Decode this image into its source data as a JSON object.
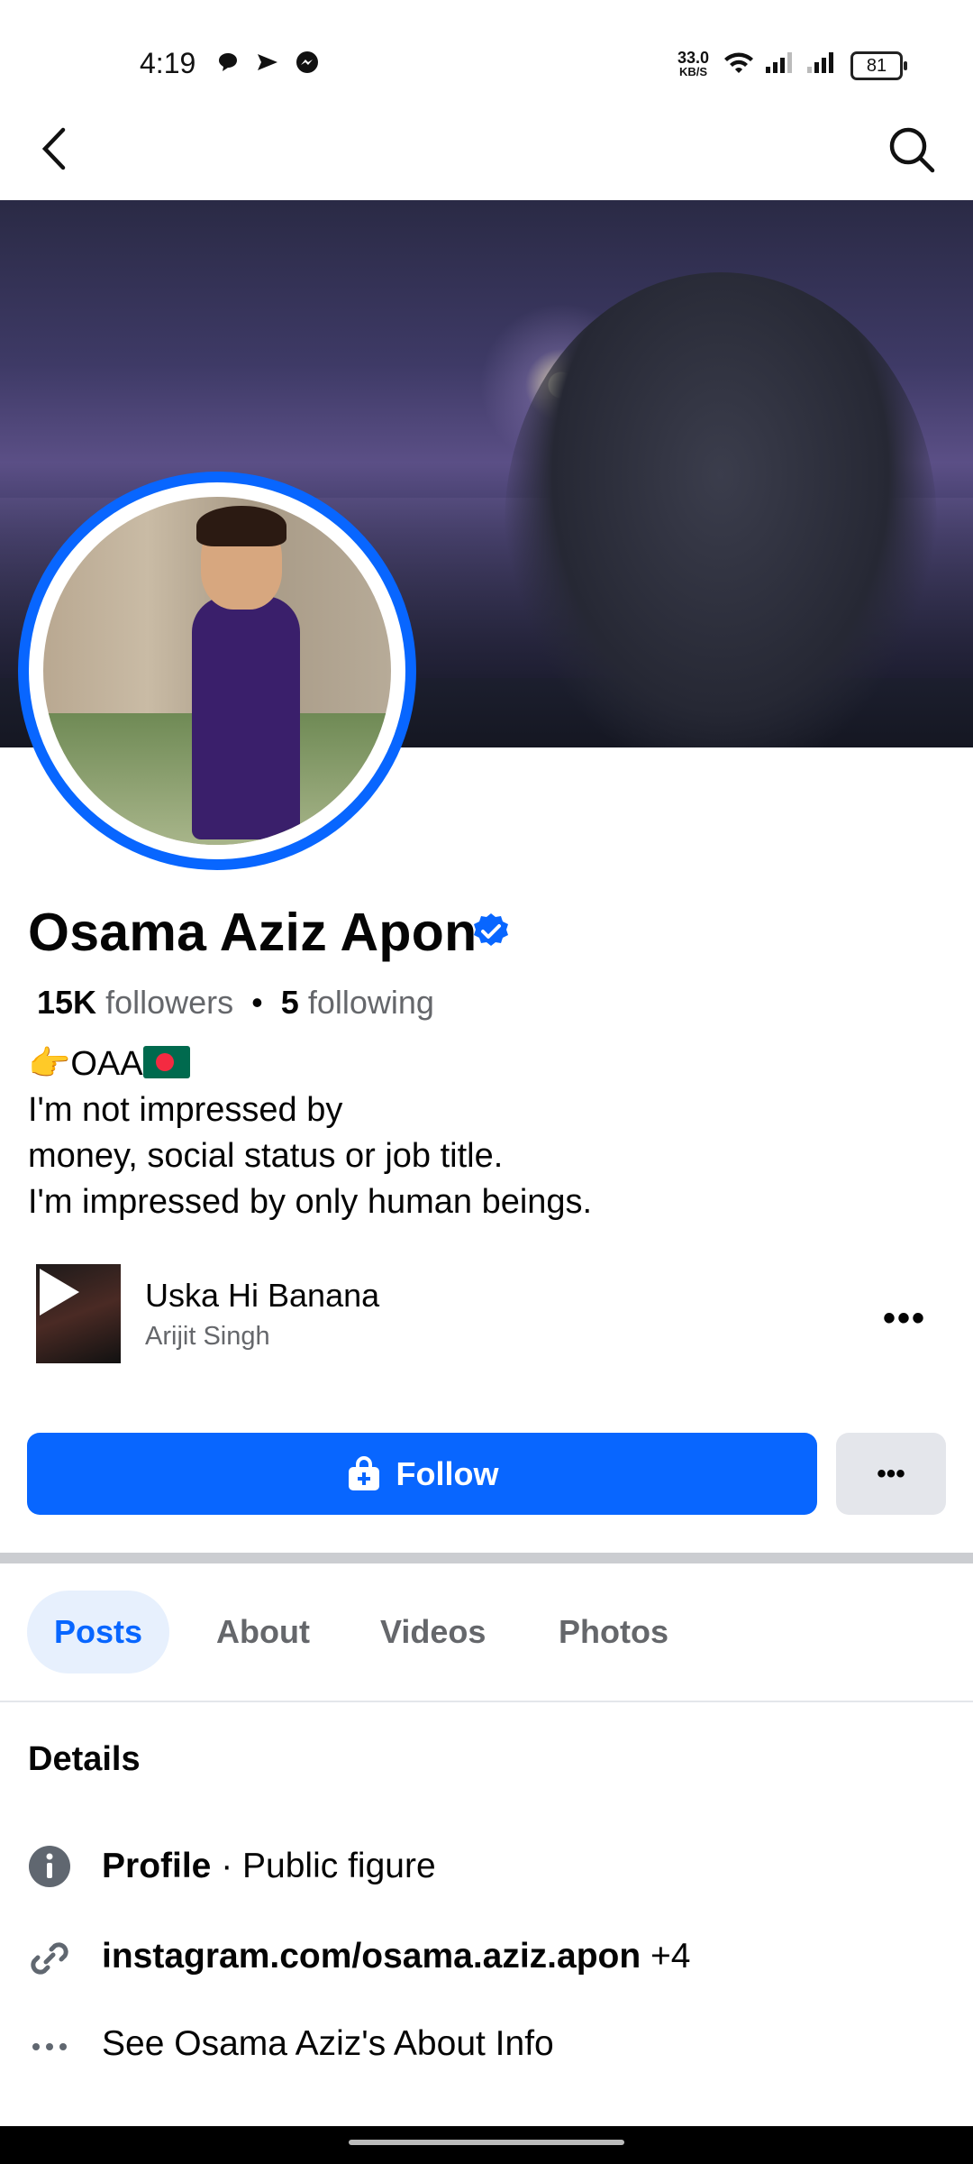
{
  "status_bar": {
    "time": "4:19",
    "net_speed_value": "33.0",
    "net_speed_unit": "KB/S",
    "battery": "81"
  },
  "header": {
    "back_icon": "back-arrow-icon",
    "search_icon": "search-icon"
  },
  "profile": {
    "name": "Osama Aziz Apon",
    "verified": true,
    "followers_count": "15K",
    "followers_label": "followers",
    "following_count": "5",
    "following_label": "following",
    "bio_line1_text": "OAA",
    "bio_line2": "I'm not impressed by",
    "bio_line3": "money, social status or job title.",
    "bio_line4": "I'm impressed by only human beings."
  },
  "music": {
    "song": "Uska Hi Banana",
    "artist": "Arijit Singh",
    "more": "•••"
  },
  "actions": {
    "follow_label": "Follow",
    "more_label": "•••"
  },
  "tabs": [
    {
      "label": "Posts",
      "active": true
    },
    {
      "label": "About",
      "active": false
    },
    {
      "label": "Videos",
      "active": false
    },
    {
      "label": "Photos",
      "active": false
    }
  ],
  "details": {
    "title": "Details",
    "profile_label": "Profile",
    "profile_value": " · Public figure",
    "link": "instagram.com/osama.aziz.apon",
    "link_extra": " +4",
    "about_info": "See Osama Aziz's About Info"
  },
  "colors": {
    "accent": "#0866ff",
    "tab_active_bg": "#e7f0fd",
    "secondary_text": "#65676b"
  }
}
